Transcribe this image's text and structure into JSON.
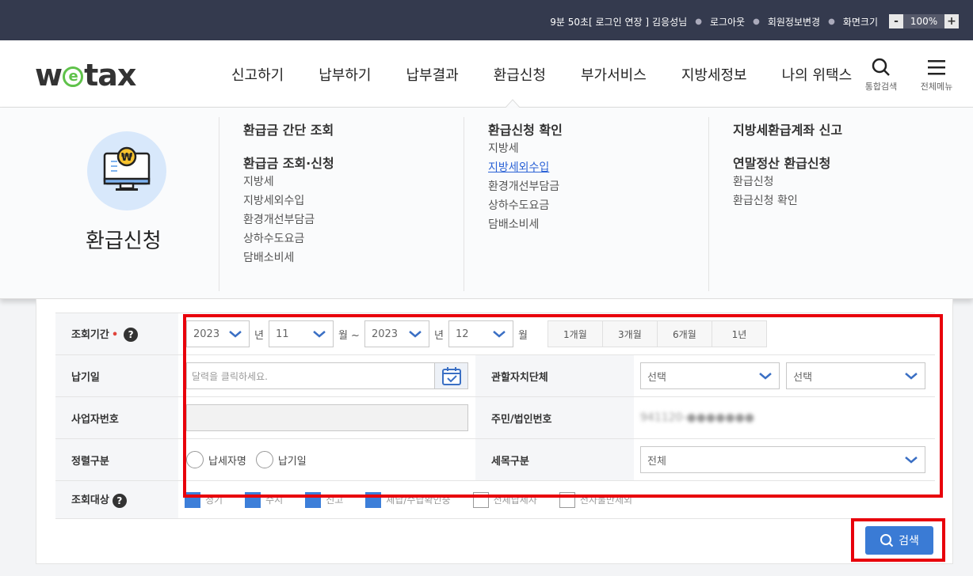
{
  "topbar": {
    "session_time": "9분 50초",
    "login_extend": "[ 로그인 연장 ]",
    "user": "김응성님",
    "logout": "로그아웃",
    "edit_member": "회원정보변경",
    "screen_size": "화면크기",
    "zoom_minus": "-",
    "zoom_value": "100%",
    "zoom_plus": "+"
  },
  "header": {
    "logo_left": "w",
    "logo_e": "e",
    "logo_right": "tax",
    "menu": [
      "신고하기",
      "납부하기",
      "납부결과",
      "환급신청",
      "부가서비스",
      "지방세정보",
      "나의 위택스"
    ],
    "search_label": "통합검색",
    "all_menu_label": "전체메뉴",
    "search_icon": "search-icon",
    "menu_icon": "hamburger-icon"
  },
  "mega": {
    "section_title": "환급신청",
    "badge_symbol": "₩",
    "col1": {
      "h1": "환급금 간단 조회",
      "h2": "환급금 조회·신청",
      "items": [
        "지방세",
        "지방세외수입",
        "환경개선부담금",
        "상하수도요금",
        "담배소비세"
      ]
    },
    "col2": {
      "h1": "환급신청 확인",
      "items": [
        "지방세",
        "지방세외수입",
        "환경개선부담금",
        "상하수도요금",
        "담배소비세"
      ]
    },
    "col3": {
      "h1": "지방세환급계좌 신고",
      "h2": "연말정산 환급신청",
      "items": [
        "환급신청",
        "환급신청 확인"
      ]
    }
  },
  "form": {
    "period_label": "조회기간",
    "required_mark": "•",
    "help_mark": "?",
    "from_year": "2023",
    "from_month": "11",
    "to_year": "2023",
    "to_month": "12",
    "unit_year": "년",
    "unit_month_tilde": "월 ~",
    "unit_month": "월",
    "period_buttons": [
      "1개월",
      "3개월",
      "6개월",
      "1년"
    ],
    "pay_date_label": "납기일",
    "pay_date_placeholder": "달력을 클릭하세요.",
    "jurisdiction_label": "관할자치단체",
    "jurisdiction_sel1": "선택",
    "jurisdiction_sel2": "선택",
    "biz_no_label": "사업자번호",
    "resident_no_label": "주민/법인번호",
    "resident_no_value": "941120-●●●●●●●",
    "sort_label": "정렬구분",
    "sort_options": [
      "납세자명",
      "납기일"
    ],
    "tax_type_label": "세목구분",
    "tax_type_value": "전체",
    "target_label": "조회대상",
    "targets": [
      {
        "label": "정기",
        "checked": true
      },
      {
        "label": "수시",
        "checked": true
      },
      {
        "label": "신고",
        "checked": true
      },
      {
        "label": "체납/수납확인중",
        "checked": true
      },
      {
        "label": "전체납세자",
        "checked": false
      },
      {
        "label": "전자불만제외",
        "checked": false
      }
    ],
    "search_button": "검색"
  }
}
